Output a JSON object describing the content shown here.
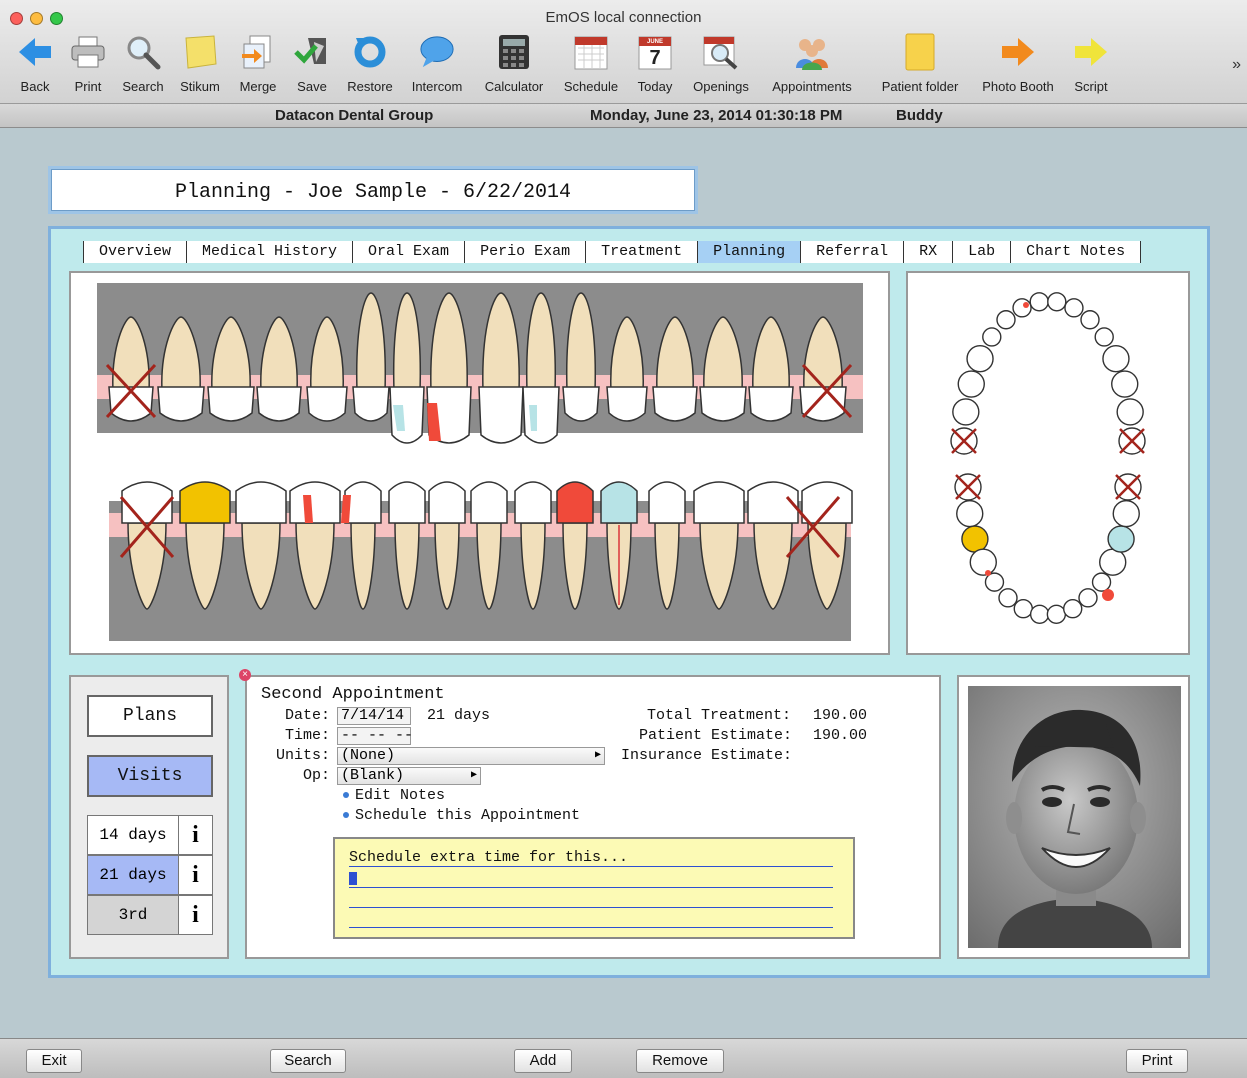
{
  "window": {
    "title": "EmOS local connection"
  },
  "toolbar": {
    "items": [
      {
        "label": "Back",
        "icon": "back-arrow-icon"
      },
      {
        "label": "Print",
        "icon": "printer-icon"
      },
      {
        "label": "Search",
        "icon": "magnifier-icon"
      },
      {
        "label": "Stikum",
        "icon": "sticky-note-icon"
      },
      {
        "label": "Merge",
        "icon": "merge-icon"
      },
      {
        "label": "Save",
        "icon": "save-icon"
      },
      {
        "label": "Restore",
        "icon": "restore-icon"
      },
      {
        "label": "Intercom",
        "icon": "speech-bubble-icon"
      },
      {
        "label": "Calculator",
        "icon": "calculator-icon"
      },
      {
        "label": "Schedule",
        "icon": "calendar-icon"
      },
      {
        "label": "Today",
        "icon": "calendar-today-icon"
      },
      {
        "label": "Openings",
        "icon": "calendar-search-icon"
      },
      {
        "label": "Appointments",
        "icon": "people-icon"
      },
      {
        "label": "Patient folder",
        "icon": "folder-icon"
      },
      {
        "label": "Photo Booth",
        "icon": "orange-arrow-icon"
      },
      {
        "label": "Script",
        "icon": "yellow-arrow-icon"
      }
    ],
    "today_number": "7",
    "today_month": "JUNE",
    "overflow": "»"
  },
  "infobar": {
    "practice": "Datacon Dental Group",
    "datetime": "Monday, June 23, 2014  01:30:18 PM",
    "user": "Buddy"
  },
  "header": {
    "title": "Planning - Joe Sample -  6/22/2014"
  },
  "tabs": [
    "Overview",
    "Medical History",
    "Oral Exam",
    "Perio Exam",
    "Treatment",
    "Planning",
    "Referral",
    "RX",
    "Lab",
    "Chart Notes"
  ],
  "active_tab": "Planning",
  "left": {
    "plans_label": "Plans",
    "visits_label": "Visits",
    "visits": [
      {
        "label": "14 days",
        "info": "i"
      },
      {
        "label": "21 days",
        "info": "i"
      },
      {
        "label": "3rd",
        "info": "i"
      }
    ]
  },
  "appointment": {
    "close": "×",
    "heading": "Second Appointment",
    "date_label": "Date:",
    "date_value": "7/14/14",
    "date_after": "21 days",
    "time_label": "Time:",
    "time_value": "-- -- --",
    "units_label": "Units:",
    "units_value": "(None)",
    "op_label": "Op:",
    "op_value": "(Blank)",
    "edit_notes": "Edit Notes",
    "schedule_link": "Schedule this Appointment",
    "total_label": "Total Treatment:",
    "total_value": "190.00",
    "patient_label": "Patient Estimate:",
    "patient_value": "190.00",
    "insurance_label": "Insurance Estimate:",
    "note_text": "Schedule extra time for this...",
    "popup_arrow": "▶"
  },
  "bottom": {
    "exit": "Exit",
    "search": "Search",
    "add": "Add",
    "remove": "Remove",
    "print": "Print"
  },
  "colors": {
    "accent_blue": "#a6d0f4",
    "visits_blue": "#a6b9f5",
    "panel_cyan": "#bfeaec",
    "filling_red": "#f04a3a",
    "crown_gold": "#f2c200",
    "sealant_cyan": "#b7e3e6"
  }
}
